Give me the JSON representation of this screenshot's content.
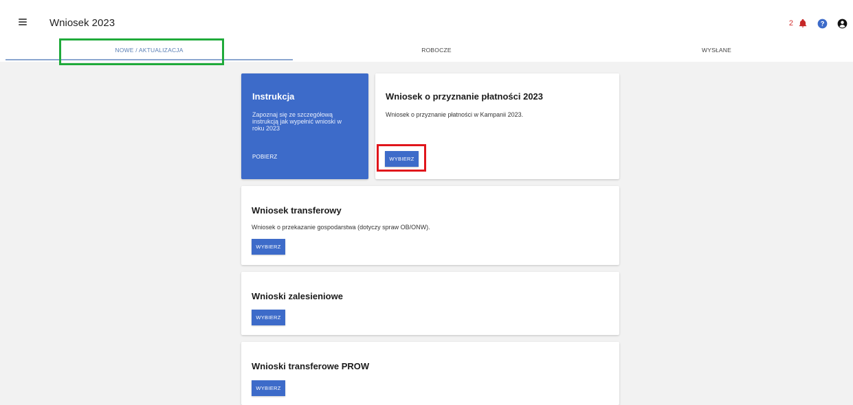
{
  "header": {
    "title": "Wniosek 2023",
    "notifications_count": "2"
  },
  "tabs": [
    {
      "label": "NOWE / AKTUALIZACJA",
      "active": true
    },
    {
      "label": "ROBOCZE",
      "active": false
    },
    {
      "label": "WYSŁANE",
      "active": false
    }
  ],
  "instruction_card": {
    "title": "Instrukcja",
    "description": "Zapoznaj się ze szczegółową instrukcją jak wypełnić wnioski w roku 2023",
    "link_label": "POBIERZ"
  },
  "cards": [
    {
      "title": "Wniosek o przyznanie płatności 2023",
      "description": "Wniosek o przyznanie płatności w Kampanii 2023.",
      "button_label": "WYBIERZ"
    },
    {
      "title": "Wniosek transferowy",
      "description": "Wniosek o przekazanie gospodarstwa (dotyczy spraw OB/ONW).",
      "button_label": "WYBIERZ"
    },
    {
      "title": "Wnioski zalesieniowe",
      "description": "",
      "button_label": "WYBIERZ"
    },
    {
      "title": "Wnioski transferowe PROW",
      "description": "",
      "button_label": "WYBIERZ"
    }
  ],
  "colors": {
    "primary": "#3d6bc9",
    "highlight_green": "#1faa3a",
    "highlight_red": "#e0151b",
    "notification": "#d32f2f"
  },
  "icons": [
    "menu-icon",
    "bell-icon",
    "help-icon",
    "user-icon"
  ]
}
